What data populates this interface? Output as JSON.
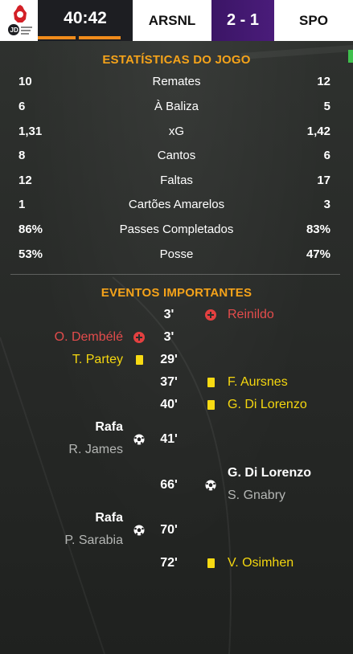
{
  "header": {
    "clock": "40:42",
    "home_team": "ARSNL",
    "score": "2 - 1",
    "away_team": "SPO",
    "logo_icon": "app-logo-icon",
    "accent": "#f08b1b",
    "score_bg": "#3b1566"
  },
  "stats": {
    "title": "ESTATÍSTICAS DO JOGO",
    "rows": [
      {
        "home": "10",
        "label": "Remates",
        "away": "12"
      },
      {
        "home": "6",
        "label": "À Baliza",
        "away": "5"
      },
      {
        "home": "1,31",
        "label": "xG",
        "away": "1,42"
      },
      {
        "home": "8",
        "label": "Cantos",
        "away": "6"
      },
      {
        "home": "12",
        "label": "Faltas",
        "away": "17"
      },
      {
        "home": "1",
        "label": "Cartões Amarelos",
        "away": "3"
      },
      {
        "home": "86%",
        "label": "Passes Completados",
        "away": "83%"
      },
      {
        "home": "53%",
        "label": "Posse",
        "away": "47%"
      }
    ]
  },
  "events": {
    "title": "EVENTOS IMPORTANTES",
    "items": [
      {
        "minute": "3'",
        "side": "away",
        "type": "sub",
        "player": "Reinildo"
      },
      {
        "minute": "3'",
        "side": "home",
        "type": "sub",
        "player": "O. Dembélé"
      },
      {
        "minute": "29'",
        "side": "home",
        "type": "yellow",
        "player": "T. Partey"
      },
      {
        "minute": "37'",
        "side": "away",
        "type": "yellow",
        "player": "F. Aursnes"
      },
      {
        "minute": "40'",
        "side": "away",
        "type": "yellow",
        "player": "G. Di Lorenzo"
      },
      {
        "minute": "41'",
        "side": "home",
        "type": "goal",
        "player": "Rafa",
        "assist": "R. James"
      },
      {
        "minute": "66'",
        "side": "away",
        "type": "goal",
        "player": "G. Di Lorenzo",
        "assist": "S. Gnabry"
      },
      {
        "minute": "70'",
        "side": "home",
        "type": "goal",
        "player": "Rafa",
        "assist": "P. Sarabia"
      },
      {
        "minute": "72'",
        "side": "away",
        "type": "yellow",
        "player": "V. Osimhen"
      }
    ]
  },
  "colors": {
    "section_title": "#f5a31a",
    "sub_red": "#e34c4c",
    "yellow": "#f5d70f"
  }
}
